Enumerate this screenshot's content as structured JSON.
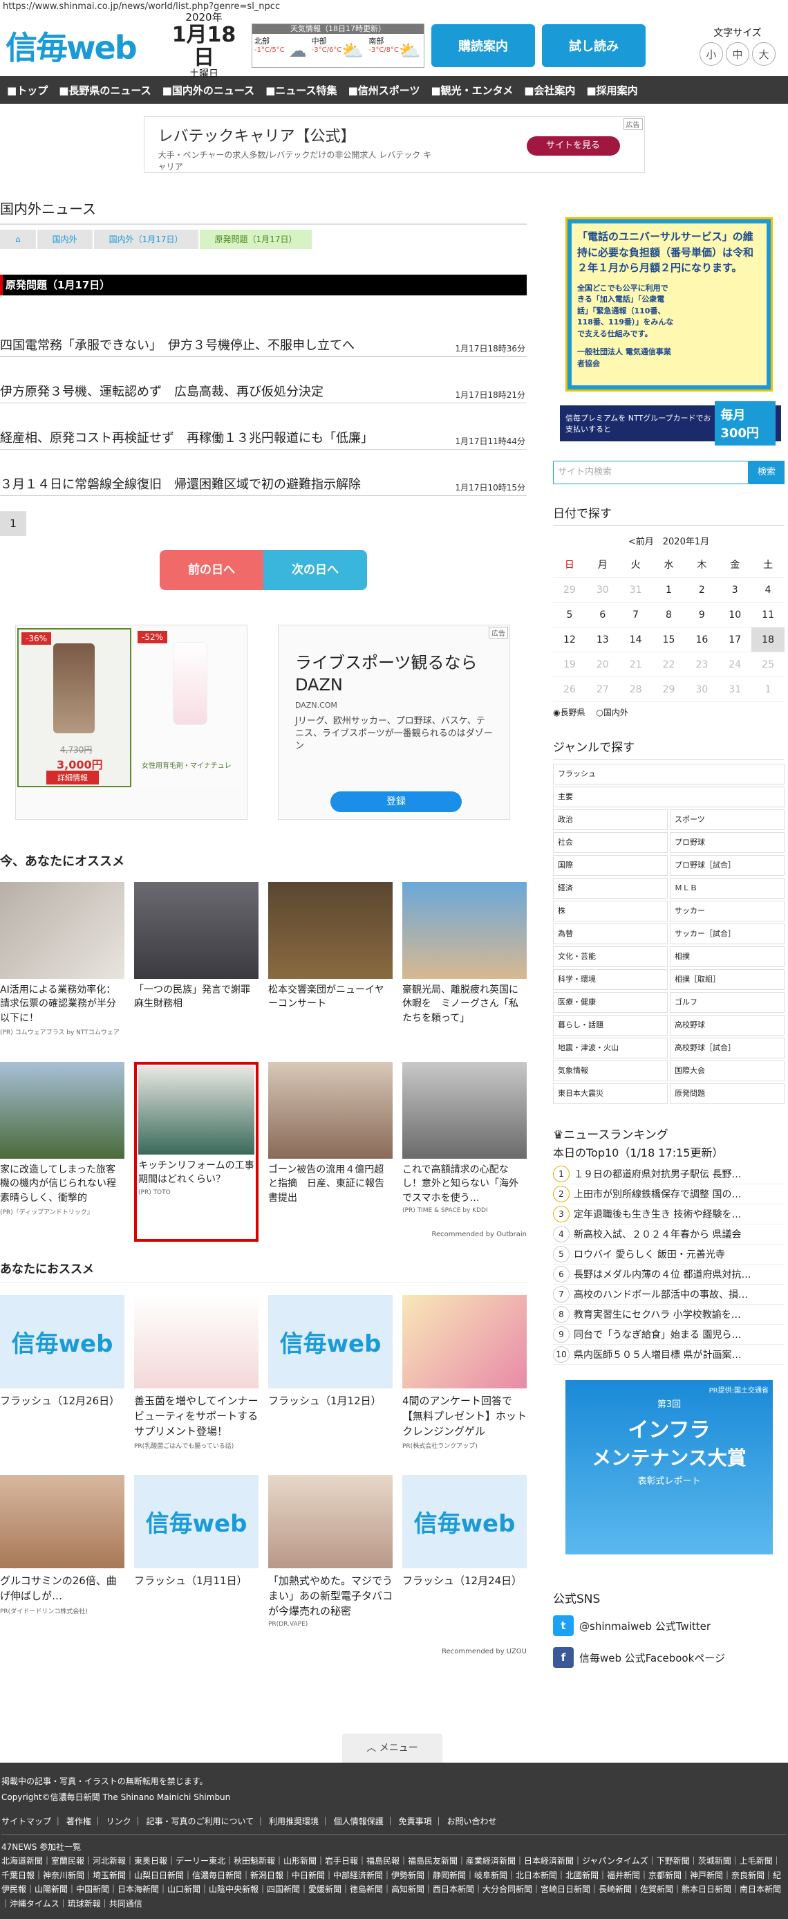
{
  "url": "https://www.shinmai.co.jp/news/world/list.php?genre=sl_npcc",
  "header": {
    "logo": "信毎web",
    "year": "2020年",
    "month_day": "1月18日",
    "weekday": "土曜日",
    "weather": {
      "title": "天気情報（18日17時更新）",
      "regions": [
        {
          "name": "北部",
          "temp": "-1°C/5°C"
        },
        {
          "name": "中部",
          "temp": "-3°C/6°C"
        },
        {
          "name": "南部",
          "temp": "-3°C/8°C"
        }
      ]
    },
    "btn_subscribe": "購読案内",
    "btn_trial": "試し読み",
    "font_size_label": "文字サイズ",
    "font_sizes": [
      "小",
      "中",
      "大"
    ]
  },
  "nav": [
    "トップ",
    "長野県のニュース",
    "国内外のニュース",
    "ニュース特集",
    "信州スポーツ",
    "観光・エンタメ",
    "会社案内",
    "採用案内"
  ],
  "top_ad": {
    "title": "レバテックキャリア【公式】",
    "desc": "大手・ベンチャーの求人多数/レバテックだけの非公開求人 レバテック キャリア",
    "button": "サイトを見る",
    "tag": "広告"
  },
  "section_title": "国内外ニュース",
  "breadcrumb": [
    "国内外",
    "国内外（1月17日）",
    "原発問題（1月17日）"
  ],
  "category_bar": "原発問題（1月17日）",
  "news": [
    {
      "title": "四国電常務「承服できない」　伊方３号機停止、不服申し立てへ",
      "time": "1月17日18時36分"
    },
    {
      "title": "伊方原発３号機、運転認めず　広島高裁、再び仮処分決定",
      "time": "1月17日18時21分"
    },
    {
      "title": "経産相、原発コスト再検証せず　再稼働１３兆円報道にも「低廉」",
      "time": "1月17日11時44分"
    },
    {
      "title": "３月１４日に常磐線全線復旧　帰還困難区域で初の避難指示解除",
      "time": "1月17日10時15分"
    }
  ],
  "page_number": "1",
  "prev_day": "前の日へ",
  "next_day": "次の日へ",
  "ad_left": {
    "disc1": "-36%",
    "disc2": "-52%",
    "price_old": "4,730円",
    "price_new": "3,000円",
    "detail": "詳細情報",
    "caption": "女性用育毛剤・マイナチュレ"
  },
  "ad_right": {
    "title": "ライブスポーツ観るならDAZN",
    "site": "DAZN.COM",
    "desc": "Jリーグ、欧州サッカー、プロ野球、バスケ、テニス、ライブスポーツが一番観られるのはダゾーン",
    "button": "登録",
    "tag": "広告"
  },
  "recommend_title": "今、あなたにオススメ",
  "recommend": [
    {
      "title": "AI活用による業務効率化：請求伝票の確認業務が半分以下に！",
      "src": "(PR) コムウェアプラス by NTTコムウェア"
    },
    {
      "title": "「一つの民族」発言で謝罪　麻生財務相",
      "src": ""
    },
    {
      "title": "松本交響楽団がニューイヤーコンサート",
      "src": ""
    },
    {
      "title": "豪観光局、離脱疲れ英国に休暇を　ミノーグさん「私たちを頼って」",
      "src": ""
    },
    {
      "title": "家に改造してしまった旅客機の機内が信じられない程素晴らしく、衝撃的",
      "src": "(PR)『ディップアンドトリック』"
    },
    {
      "title": "キッチンリフォームの工事期間はどれくらい？",
      "src": "(PR) TOTO"
    },
    {
      "title": "ゴーン被告の流用４億円超と指摘　日産、東証に報告書提出",
      "src": ""
    },
    {
      "title": "これで高額請求の心配なし！意外と知らない「海外でスマホを使う…",
      "src": "(PR) TIME & SPACE by KDDI"
    }
  ],
  "outbrain": "Recommended by Outbrain",
  "recommend2_title": "あなたにおススメ",
  "recommend2": [
    {
      "title": "フラッシュ（12月26日）",
      "src": ""
    },
    {
      "title": "善玉菌を増やしてインナービューティをサポートするサプリメント登場！",
      "src": "PR(乳酸菌ごはんでも腸っている話)"
    },
    {
      "title": "フラッシュ（1月12日）",
      "src": ""
    },
    {
      "title": "4間のアンケート回答で【無料プレゼント】ホットクレンジングゲル",
      "src": "PR(株式会社ランクアップ)"
    },
    {
      "title": "グルコサミンの26倍、曲げ伸ばしが…",
      "src": "PR(ダイドードリンコ株式会社)"
    },
    {
      "title": "フラッシュ（1月11日）",
      "src": ""
    },
    {
      "title": "「加熱式やめた。マジでうまい」あの新型電子タバコが今爆売れの秘密",
      "src": "PR(DR.VAPE)"
    },
    {
      "title": "フラッシュ（12月24日）",
      "src": ""
    }
  ],
  "uzou": "Recommended by UZOU",
  "side": {
    "ad_big": "「電話のユニバーサルサービス」の維持に必要な負担額（番号単価）は令和２年１月から月額２円になります。",
    "ad_small": "全国どこでも公平に利用できる「加入電話」「公衆電話」「緊急通報（110番、118番、119番）」をみんなで支える仕組みです。",
    "ad_org": "一般社団法人 電気通信事業者協会",
    "premium": "信毎プレミアムを NTTグループカードでお支払いすると",
    "premium_yen": "毎月300円",
    "search_placeholder": "サイト内検索",
    "search_btn": "検索",
    "date_title": "日付で探す",
    "cal_head": "<前月　2020年1月",
    "weekdays": [
      "日",
      "月",
      "火",
      "水",
      "木",
      "金",
      "土"
    ],
    "radio1": "長野県",
    "radio2": "国内外",
    "genre_title": "ジャンルで探す",
    "genre_full": [
      "フラッシュ",
      "主要"
    ],
    "genre_pairs": [
      [
        "政治",
        "スポーツ"
      ],
      [
        "社会",
        "プロ野球"
      ],
      [
        "国際",
        "プロ野球［試合］"
      ],
      [
        "経済",
        "ＭＬＢ"
      ],
      [
        "株",
        "サッカー"
      ],
      [
        "為替",
        "サッカー［試合］"
      ],
      [
        "文化・芸能",
        "相撲"
      ],
      [
        "科学・環境",
        "相撲［取組］"
      ],
      [
        "医療・健康",
        "ゴルフ"
      ],
      [
        "暮らし・話題",
        "高校野球"
      ],
      [
        "地震・津波・火山",
        "高校野球［試合］"
      ],
      [
        "気象情報",
        "国際大会"
      ],
      [
        "東日本大震災",
        "原発問題"
      ]
    ],
    "rank_title": "ニュースランキング",
    "rank_sub": "本日のTop10（1/18 17:15更新）",
    "ranking": [
      "１９日の都道府県対抗男子駅伝 長野…",
      "上田市が別所線鉄橋保存で調整 国の…",
      "定年退職後も生き生き 技術や経験を…",
      "新高校入試、２０２４年春から 県議会",
      "ロウバイ 愛らしく 飯田・元善光寺",
      "長野はメダル内薄の４位 都道府県対抗…",
      "高校のハンドボール部活中の事故、損…",
      "教育実習生にセクハラ 小学校教諭を…",
      "同台で「うなぎ給食」始まる 園児ら…",
      "県内医師５０５人増目標 県が計画案…"
    ],
    "infra1": "第3回",
    "infra2": "インフラ",
    "infra3": "メンテナンス大賞",
    "infra4": "表彰式レポート",
    "infra_tag": "PR提供:国土交通省",
    "sns_title": "公式SNS",
    "sns_twitter": "@shinmaiweb 公式Twitter",
    "sns_fb": "信毎web 公式Facebookページ"
  },
  "menu": "メニュー",
  "footer": {
    "l1": "掲載中の記事・写真・イラストの無断転用を禁じます。",
    "l2": "Copyright©信濃毎日新聞 The Shinano Mainichi Shimbun",
    "links": [
      "サイトマップ",
      "著作権",
      "リンク",
      "記事・写真のご利用について",
      "利用推奨環境",
      "個人情報保護",
      "免責事項",
      "お問い合わせ"
    ],
    "np_title": "47NEWS 参加社一覧",
    "papers": "北海道新聞｜室蘭民報｜河北新報｜東奥日報｜デーリー東北｜秋田魁新報｜山形新聞｜岩手日報｜福島民報｜福島民友新聞｜産業経済新聞｜日本経済新聞｜ジャパンタイムズ｜下野新聞｜茨城新聞｜上毛新聞｜千葉日報｜神奈川新聞｜埼玉新聞｜山梨日日新聞｜信濃毎日新聞｜新潟日報｜中日新聞｜中部経済新聞｜伊勢新聞｜静岡新聞｜岐阜新聞｜北日本新聞｜北國新聞｜福井新聞｜京都新聞｜神戸新聞｜奈良新聞｜紀伊民報｜山陽新聞｜中国新聞｜日本海新聞｜山口新聞｜山陰中央新報｜四国新聞｜愛媛新聞｜徳島新聞｜高知新聞｜西日本新聞｜大分合同新聞｜宮崎日日新聞｜長崎新聞｜佐賀新聞｜熊本日日新聞｜南日本新聞｜沖縄タイムス｜琉球新報｜共同通信"
  }
}
